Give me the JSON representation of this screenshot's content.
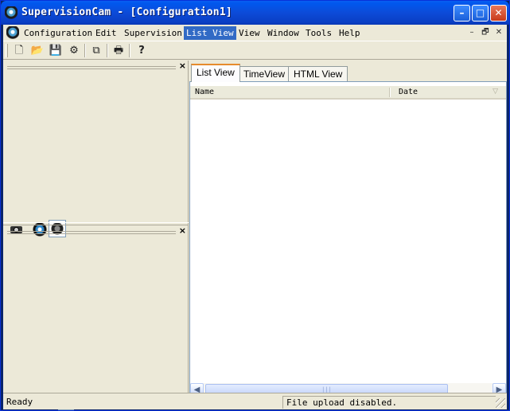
{
  "window": {
    "title": "SupervisionCam - [Configuration1]"
  },
  "menu": {
    "items": [
      "Configuration",
      "Edit",
      "Supervision",
      "List View",
      "View",
      "Window",
      "Tools",
      "Help"
    ],
    "active": "List View"
  },
  "mdi_controls": [
    "–",
    "🗗",
    "✕"
  ],
  "toolbar": {
    "buttons": [
      {
        "name": "new-icon",
        "glyph": "🗋"
      },
      {
        "name": "open-icon",
        "glyph": "📂"
      },
      {
        "name": "save-icon",
        "glyph": "💾"
      },
      {
        "name": "properties-icon",
        "glyph": "⚙"
      },
      {
        "name": "copy-icon",
        "glyph": "⧉"
      },
      {
        "name": "print-icon",
        "glyph": "🖶"
      },
      {
        "name": "help-icon",
        "glyph": "?"
      }
    ]
  },
  "left_panes": {
    "close_glyph": "×"
  },
  "player": {
    "first": "⏮",
    "prev": "◀",
    "next": "▶",
    "last": "⏭",
    "stop": "■",
    "play": "▷"
  },
  "tabs": [
    {
      "label": "List View",
      "selected": true
    },
    {
      "label": "TimeView",
      "selected": false
    },
    {
      "label": "HTML View",
      "selected": false
    }
  ],
  "list": {
    "columns": [
      "Name",
      "Date"
    ],
    "rows": []
  },
  "scrollbar": {
    "left": "◀",
    "right": "▶",
    "thumb": "|||"
  },
  "status": {
    "left": "Ready",
    "right": "File upload disabled."
  },
  "colors": {
    "title_blue": "#0c4bd8",
    "face": "#ece9d8",
    "highlight": "#316ac5",
    "tab_accent": "#e68b2c"
  }
}
